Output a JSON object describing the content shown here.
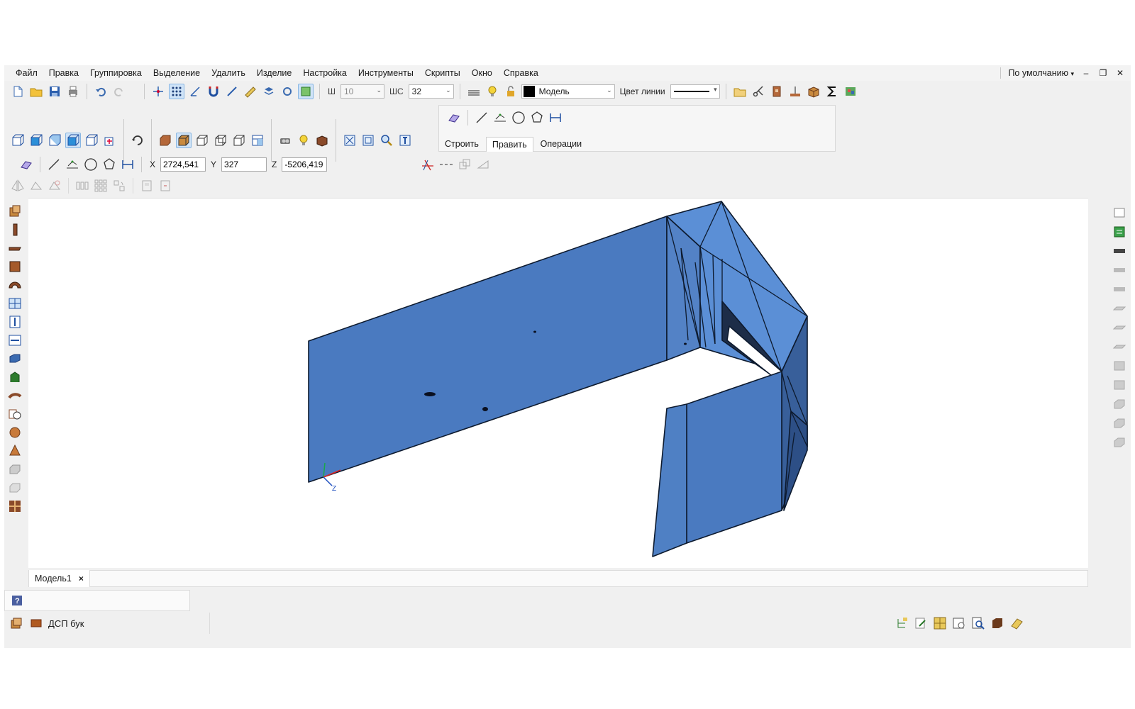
{
  "menu": {
    "items": [
      "Файл",
      "Правка",
      "Группировка",
      "Выделение",
      "Удалить",
      "Изделие",
      "Настройка",
      "Инструменты",
      "Скрипты",
      "Окно",
      "Справка"
    ],
    "profile": "По умолчанию"
  },
  "toolbar": {
    "width_label": "Ш",
    "width_value": "10",
    "step_label": "ШС",
    "step_value": "32",
    "layer_value": "Модель",
    "line_color_label": "Цвет линии"
  },
  "builder": {
    "tabs": [
      "Строить",
      "Править",
      "Операции"
    ]
  },
  "coords": {
    "x_label": "X",
    "x_value": "2724,541",
    "y_label": "Y",
    "y_value": "327",
    "z_label": "Z",
    "z_value": "-5206,419"
  },
  "viewport": {
    "fill_color": "#4a7ac0",
    "edge_color": "#0d1a2e",
    "axis_label": "Z"
  },
  "doc_tab": {
    "label": "Модель1",
    "close": "×"
  },
  "status": {
    "material": "ДСП бук"
  }
}
